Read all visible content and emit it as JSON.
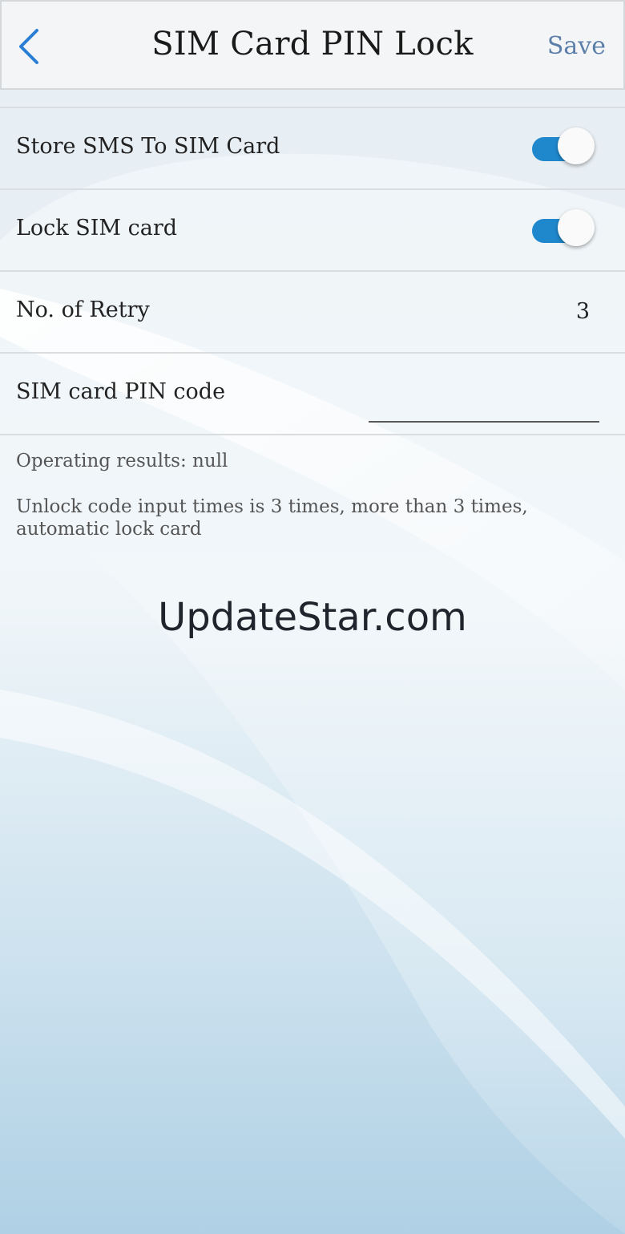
{
  "header": {
    "title": "SIM Card PIN Lock",
    "save_label": "Save",
    "back_icon": "chevron-left-icon"
  },
  "settings": {
    "store_sms": {
      "label": "Store SMS To SIM Card",
      "enabled": true
    },
    "lock_sim": {
      "label": "Lock SIM card",
      "enabled": true
    },
    "retry": {
      "label": "No. of Retry",
      "value": "3"
    },
    "pin_code": {
      "label": "SIM card PIN code",
      "value": ""
    }
  },
  "info": {
    "operating_results": "Operating results:  null",
    "unlock_note": "Unlock code input times is 3 times, more than 3 times, automatic lock card"
  },
  "watermark": "UpdateStar.com",
  "colors": {
    "accent": "#1f88cc",
    "save_text": "#5b7fa8",
    "back_icon": "#2a7fd4"
  }
}
